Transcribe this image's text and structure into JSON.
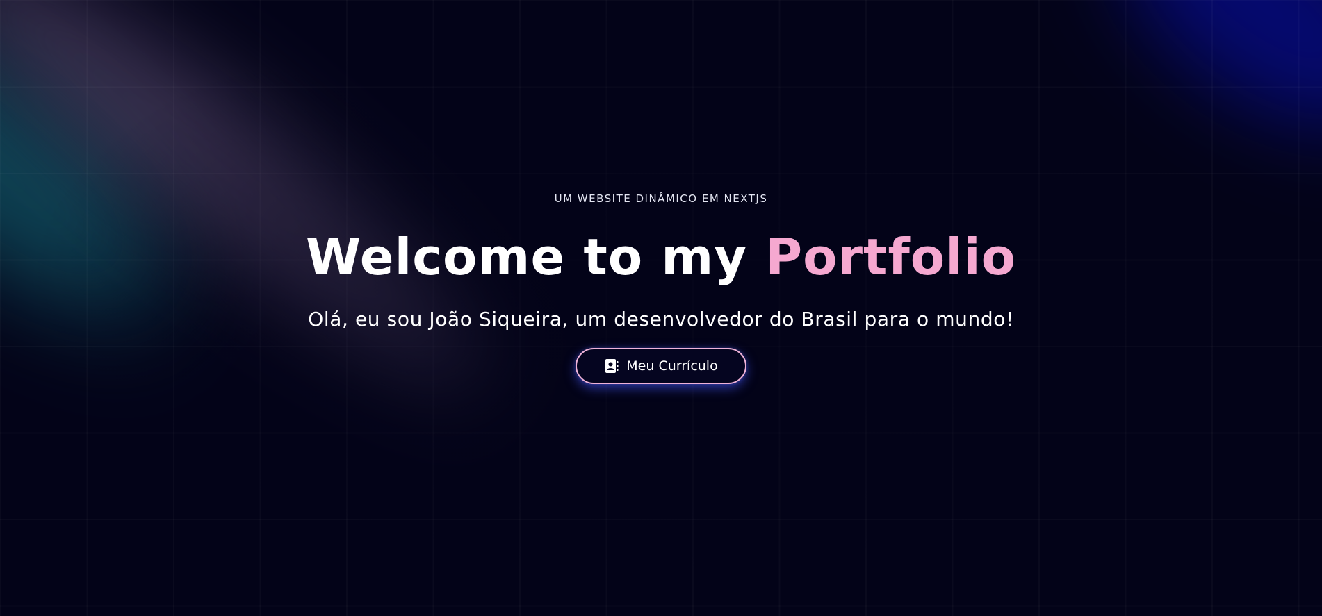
{
  "hero": {
    "eyebrow": "UM WEBSITE DINÂMICO EM NEXTJS",
    "headline_prefix": "Welcome to my ",
    "headline_accent": "Portfolio",
    "subtitle": "Olá, eu sou João Siqueira, um desenvolvedor do Brasil para o mundo!",
    "cta": {
      "label": "Meu Currículo",
      "icon": "contact-book-icon"
    }
  },
  "colors": {
    "background": "#030318",
    "accent": "#f5a8d0",
    "button_border": "#f0b3d8",
    "button_glow": "#465aff",
    "text": "#ffffff"
  }
}
